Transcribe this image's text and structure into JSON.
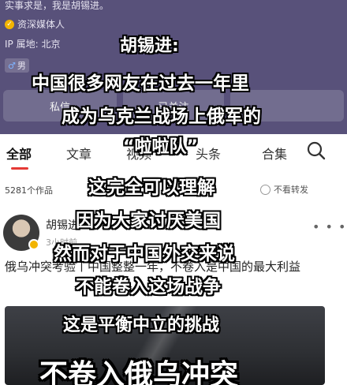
{
  "profile": {
    "bio": "实事求是，我是胡锡进。",
    "certification": "资深媒体人",
    "ip_location": "IP 属地: 北京",
    "gender_label": "男",
    "buttons": [
      "私信",
      "已关注",
      ""
    ]
  },
  "tabs": [
    {
      "label": "全部",
      "active": true
    },
    {
      "label": "文章",
      "active": false
    },
    {
      "label": "视频",
      "active": false
    },
    {
      "label": "头条",
      "active": false
    },
    {
      "label": "合集",
      "active": false
    }
  ],
  "works_count": "5281个作品",
  "repost_toggle_label": "不看转发",
  "post": {
    "author": "胡锡进",
    "time": "3小时前",
    "text": "俄乌冲突考验丨中国整整一年，不卷入是中国的最大利益"
  },
  "captions": [
    "胡锡进:",
    "中国很多网友在过去一年里",
    "成为乌克兰战场上俄军的",
    "“啦啦队”",
    "这完全可以理解",
    "因为大家讨厌美国",
    "然而对于中国外交来说",
    "不能卷入这场战争",
    "这是平衡中立的挑战"
  ],
  "headline": "不卷入俄乌冲突",
  "colors": {
    "header_bg": "#58517a",
    "tab_accent": "#e53935",
    "caption_text": "#ffffff"
  }
}
